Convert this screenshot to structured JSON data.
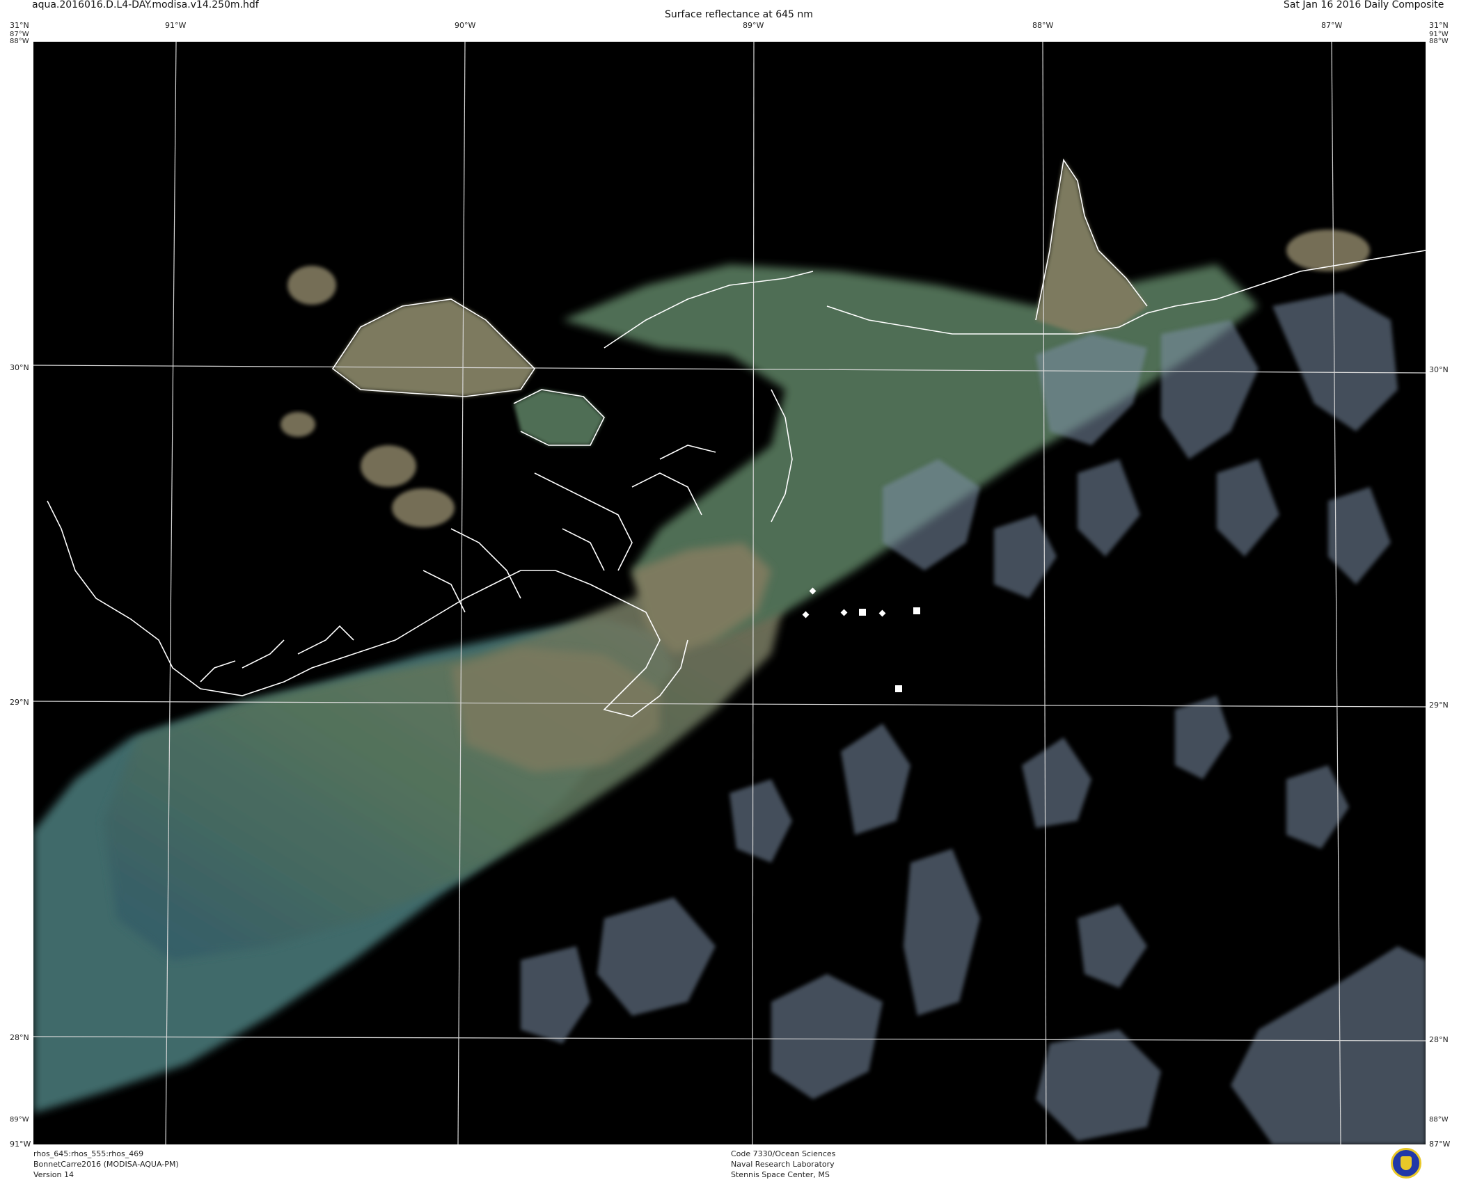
{
  "header": {
    "filename": "aqua.2016016.D.L4-DAY.modisa.v14.250m.hdf",
    "product": "Surface reflectance at 645 nm",
    "date": "Sat Jan 16 2016 Daily Composite"
  },
  "map": {
    "lon_top": [
      "91°W",
      "90°W",
      "89°W",
      "88°W",
      "87°W"
    ],
    "lat_left": [
      "30°N",
      "29°N",
      "28°N"
    ],
    "lat_right": [
      "30°N",
      "29°N",
      "28°N"
    ],
    "corner_top_left_lat": "31°N",
    "corner_top_left_a": "87°W",
    "corner_top_left_b": "88°W",
    "corner_top_right_lat": "31°N",
    "corner_top_right_a": "91°W",
    "corner_top_right_b": "88°W",
    "corner_bottom_left_a": "89°W",
    "corner_bottom_left_b": "91°W",
    "corner_bottom_right_a": "88°W",
    "corner_bottom_right_b": "87°W"
  },
  "footer": {
    "left": [
      "rhos_645:rhos_555:rhos_469",
      "BonnetCarre2016 (MODISA-AQUA-PM)",
      "Version 14"
    ],
    "center": [
      "Code 7330/Ocean Sciences",
      "Naval Research Laboratory",
      "Stennis Space Center, MS"
    ]
  },
  "icons": {
    "logo": "nrl-seal-icon",
    "station": "station-marker-icon"
  },
  "colors": {
    "background": "#000000",
    "graticule": "#d8d8d8",
    "coastline": "#ffffff"
  }
}
